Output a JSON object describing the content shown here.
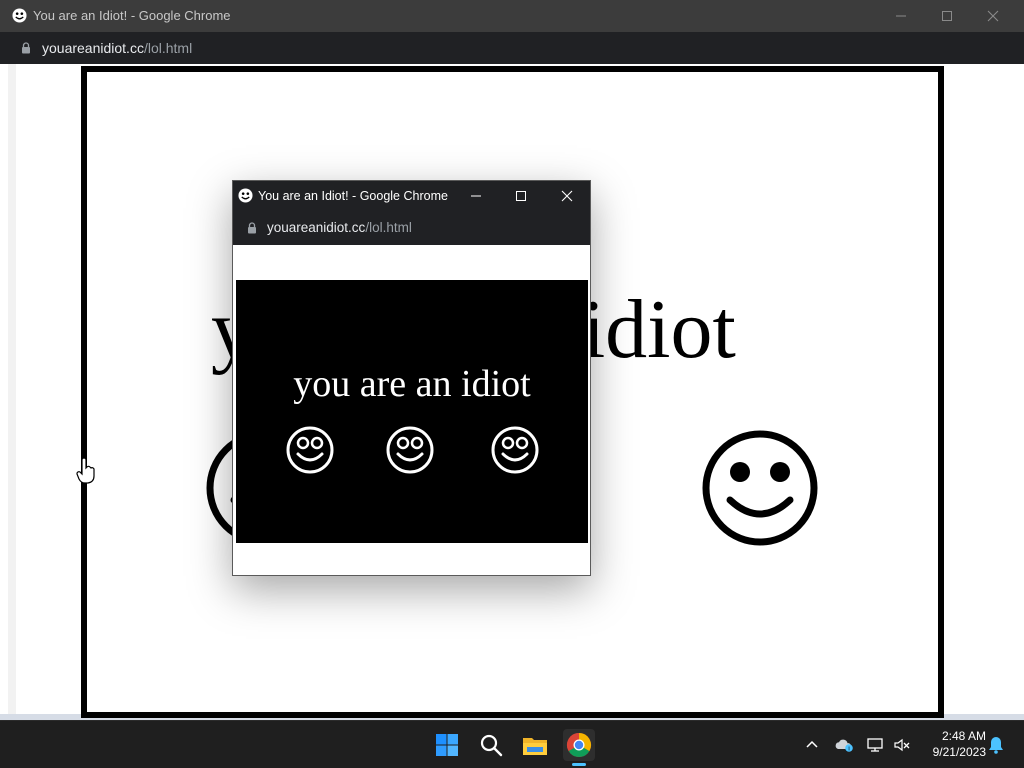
{
  "main_window": {
    "title": "You are an Idiot! - Google Chrome",
    "url_domain": "youareanidiot.cc",
    "url_path": "/lol.html",
    "page": {
      "text": "you are an idiot"
    }
  },
  "popup_window": {
    "title": "You are an Idiot! - Google Chrome",
    "url_domain": "youareanidiot.cc",
    "url_path": "/lol.html",
    "page": {
      "text": "you are an idiot",
      "smiley_count": 3
    }
  },
  "window_controls": {
    "minimize_icon": "minimize-icon",
    "maximize_icon": "maximize-icon",
    "close_icon": "close-icon"
  },
  "taskbar": {
    "pinned": [
      {
        "name": "start-button",
        "icon": "windows-logo-icon"
      },
      {
        "name": "search-button",
        "icon": "search-icon"
      },
      {
        "name": "file-explorer-button",
        "icon": "folder-icon"
      },
      {
        "name": "chrome-button",
        "icon": "chrome-icon",
        "active": true
      }
    ],
    "tray": {
      "icons": [
        "chevron-up-icon",
        "onedrive-icon",
        "network-icon",
        "volume-muted-icon"
      ],
      "time": "2:48 AM",
      "date": "9/21/2023",
      "notification_icon": "bell-icon"
    }
  },
  "colors": {
    "titlebar_dark": "#202124",
    "taskbar": "#1f1f1f",
    "accent": "#4cc2ff",
    "page_background": "#ffffff",
    "stage_background": "#000000"
  }
}
